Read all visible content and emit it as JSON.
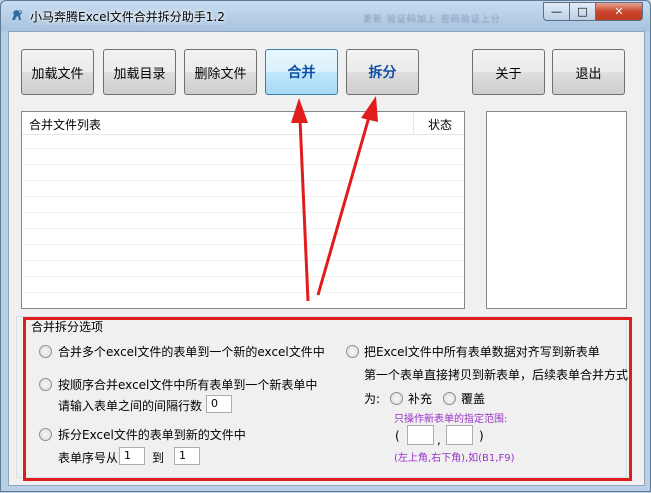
{
  "window": {
    "title": "小马奔腾Excel文件合并拆分助手1.2",
    "blurred_caption": "更新   验证码加上  密码验证上分",
    "min_glyph": "—",
    "max_glyph": "□",
    "close_glyph": "✕"
  },
  "toolbar": {
    "load_files": "加载文件",
    "load_dir": "加载目录",
    "delete_files": "删除文件",
    "merge": "合并",
    "split": "拆分",
    "about": "关于",
    "exit": "退出"
  },
  "file_list": {
    "column_name": "合并文件列表",
    "column_status": "状态"
  },
  "options": {
    "legend": "合并拆分选项",
    "opt1": "合并多个excel文件的表单到一个新的excel文件中",
    "opt2": "按顺序合并excel文件中所有表单到一个新表单中",
    "opt2_gap_label": "请输入表单之间的间隔行数",
    "opt2_gap_value": "0",
    "opt3": "拆分Excel文件的表单到新的文件中",
    "opt3_from_label": "表单序号从",
    "opt3_from_value": "1",
    "opt3_to_label": "到",
    "opt3_to_value": "1",
    "opt4": "把Excel文件中所有表单数据对齐写到新表单",
    "opt4_desc": "第一个表单直接拷贝到新表单，后续表单合并方式",
    "mode_label": "为:",
    "mode_append": "补充",
    "mode_overwrite": "覆盖",
    "range_hint": "只操作新表单的指定范围:",
    "paren_open": "(",
    "comma": ",",
    "paren_close": ")",
    "range_example": "(左上角,右下角),如(B1,F9)"
  },
  "colors": {
    "accent_text": "#0f4ea5",
    "annotation_red": "#e01c1c",
    "hint_purple": "#9b31c7"
  }
}
